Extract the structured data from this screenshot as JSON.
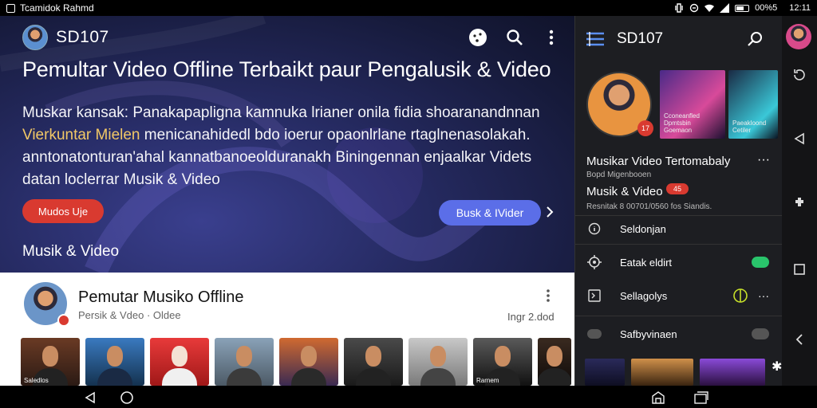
{
  "status_bar": {
    "app_name": "Tcamidok Rahmd",
    "battery_text": "00%5",
    "time": "12:11"
  },
  "hero": {
    "channel_name": "SD107",
    "title": "Pemultar Video Offline Terbaikt paur Pengalusik & Video",
    "description_line1": "Muskar kansak: Panakapapligna kamnuka lrianer onila fidia shoaranandnnan",
    "description_highlight": "Vierkuntar Mielen",
    "description_line2_rest": " menicanahidedl bdo ioerur opaonlrlane rtaglnenasolakah.",
    "description_line3": "anntonatonturan'ahal kannatbanoeolduranakh Biningennan enjaalkar Videts",
    "description_line4": "datan loclerrar Musik & Video",
    "red_button_label": "Mudos Uje",
    "blue_button_label": "Busk & IVider",
    "footer_label": "Musik & Video",
    "accent_red": "#d93a30",
    "accent_blue": "#5b6ee8"
  },
  "card": {
    "title": "Pemutar Musiko Offline",
    "subtitle": "Persik & Vdeo · Oldee",
    "date": "Ingr 2.dod",
    "thumbnails": [
      {
        "label": "Saledlos"
      },
      {
        "label": ""
      },
      {
        "label": ""
      },
      {
        "label": ""
      },
      {
        "label": ""
      },
      {
        "label": ""
      },
      {
        "label": ""
      },
      {
        "label": "Rarnem"
      },
      {
        "label": ""
      }
    ]
  },
  "drawer": {
    "channel_name": "SD107",
    "profile_badge": "17",
    "thumb1_label": "Cconeanfled\nDpmtsbin\nGoemaon",
    "thumb2_label": "Paeakloond\nCetiler",
    "title": "Musikar Video Tertomabaly",
    "sub1": "Bopd Migenbooen",
    "sub2": "Musik & Video",
    "sub2_badge": "45",
    "sub3": "Resnitak 8 00701/0560 fos Siandis.",
    "rows": [
      {
        "label": "Seldonjan",
        "icon": "info-icon"
      },
      {
        "label": "Eatak eldirt",
        "icon": "target-icon"
      },
      {
        "label": "Sellagolys",
        "icon": "media-icon"
      },
      {
        "label": "Safbyvinaen",
        "icon": "toggle-icon"
      }
    ],
    "toggle_on_color": "#29c46b",
    "indicator_color": "#c7e02a"
  },
  "nav_bar": {
    "icons": [
      "back-icon",
      "home-icon",
      "home-building-icon",
      "recents-icon"
    ]
  }
}
